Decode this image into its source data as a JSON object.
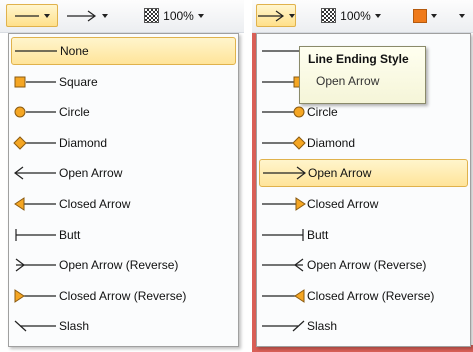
{
  "toolbar": {
    "zoom_left": "100%",
    "zoom_right": "100%"
  },
  "menu_items": [
    {
      "label": "None",
      "icon": "line-none-icon"
    },
    {
      "label": "Square",
      "icon": "line-square-icon"
    },
    {
      "label": "Circle",
      "icon": "line-circle-icon"
    },
    {
      "label": "Diamond",
      "icon": "line-diamond-icon"
    },
    {
      "label": "Open Arrow",
      "icon": "line-open-arrow-icon"
    },
    {
      "label": "Closed Arrow",
      "icon": "line-closed-arrow-icon"
    },
    {
      "label": "Butt",
      "icon": "line-butt-icon"
    },
    {
      "label": "Open Arrow (Reverse)",
      "icon": "line-open-arrow-reverse-icon"
    },
    {
      "label": "Closed Arrow (Reverse)",
      "icon": "line-closed-arrow-reverse-icon"
    },
    {
      "label": "Slash",
      "icon": "line-slash-icon"
    }
  ],
  "left_menu": {
    "highlighted": "None"
  },
  "right_menu": {
    "highlighted": "Open Arrow"
  },
  "tooltip": {
    "title": "Line Ending Style",
    "body": "Open Arrow"
  },
  "colors": {
    "accent_fill": "#ef7a1a",
    "marker": "#f5a623",
    "highlight": "#ffe49a",
    "highlight_border": "#e0b24c"
  }
}
